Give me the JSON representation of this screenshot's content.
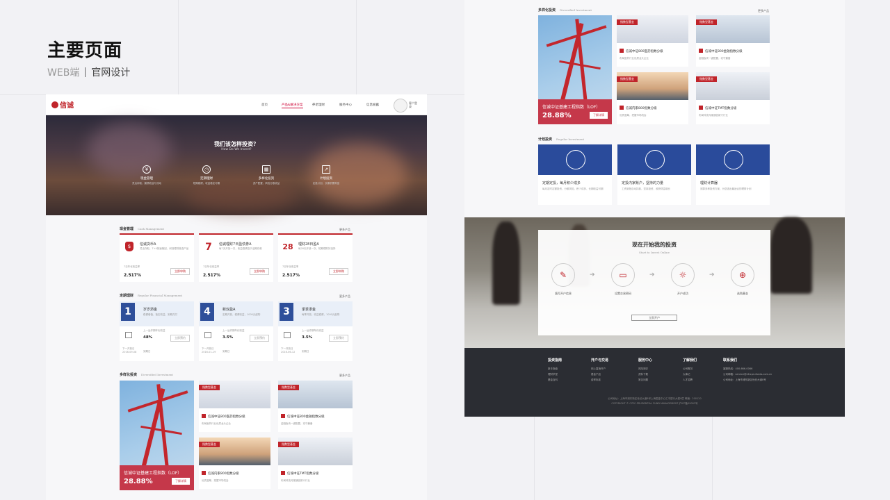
{
  "page": {
    "title": "主要页面",
    "subtitle_a": "WEB端",
    "subtitle_b": "官网设计"
  },
  "nav": {
    "logo": "信诚",
    "items": [
      "首页",
      "产品&解决方案",
      "养老理财",
      "服务中心",
      "信息披露"
    ],
    "active_index": 1,
    "user": "客户登录"
  },
  "hero": {
    "title": "我们该怎样投资？",
    "subtitle": "How Do We Invest?",
    "items": [
      {
        "icon": "yen-icon",
        "label": "现金管理",
        "desc": "灵活存取，兼顾收益与流动"
      },
      {
        "icon": "clock-icon",
        "label": "定期理财",
        "desc": "短期稳健，收益稳定可期"
      },
      {
        "icon": "grid-icon",
        "label": "多样化投资",
        "desc": "资产配置，风险分散收益"
      },
      {
        "icon": "chart-icon",
        "label": "计划投资",
        "desc": "定投计划，长期积累财富"
      }
    ]
  },
  "cash": {
    "title": "现金管理",
    "en": "Cash Management",
    "more": "更多产品",
    "cards": [
      {
        "mark": "$",
        "name": "信诚货币A",
        "desc": "灵活存取，T+0快速赎回，闲钱理财首选产品",
        "label": "7日年化收益率",
        "pct": "2.517%",
        "btn": "立即申购"
      },
      {
        "mark": "7",
        "name": "信诚理财7日盈债券A",
        "desc": "每7天开放一次，收益稳健高于活期存款",
        "label": "7日年化收益率",
        "pct": "2.517%",
        "btn": "立即申购"
      },
      {
        "mark": "28",
        "name": "理财28日盈A",
        "desc": "每28天开放一次，短期理财好选择",
        "label": "7日年化收益率",
        "pct": "2.517%",
        "btn": "立即申购"
      }
    ]
  },
  "periodic": {
    "title": "定期理财",
    "en": "Regular Financial Management",
    "more": "更多产品",
    "cards": [
      {
        "num": "1",
        "name": "岁岁添金",
        "desc": "稳健增值，锁定收益，到期兑付",
        "label": "上一运作期年化收益",
        "pct": "48%",
        "btn": "立即预约",
        "date": "下一开放日\n2016-09-08",
        "dn": "到期日"
      },
      {
        "num": "4",
        "name": "新双盈A",
        "desc": "定期开放，稳健收益，1000元起购",
        "label": "上一运作期年化收益",
        "pct": "3.5%",
        "btn": "立即预约",
        "date": "下一开放日\n2016-01-19",
        "dn": "到期日"
      },
      {
        "num": "3",
        "name": "季季添金",
        "desc": "每季开放，收益稳健，1000元起购",
        "label": "上一运作期年化收益",
        "pct": "3.5%",
        "btn": "立即预约",
        "date": "下一开放日\n2016-06-12",
        "dn": "到期日"
      }
    ]
  },
  "diverse": {
    "title": "多样化投资",
    "en": "Diversified Investment",
    "more": "更多产品",
    "featured": {
      "name": "信诚中证基建工程指数（LOF）",
      "pct": "28.88%",
      "btn": "了解详情"
    },
    "funds": [
      {
        "tag": "指数型基金",
        "name": "信诚中证800医药指数分级",
        "desc": "布局医药行业优质龙头企业",
        "img": "dna"
      },
      {
        "tag": "指数型基金",
        "name": "信诚中证800金融指数分级",
        "desc": "金融板块一键配置，攻守兼备",
        "img": "sky"
      },
      {
        "tag": "指数型基金",
        "name": "信诚内家800指数分级",
        "desc": "优质蓝筹，把握市场机会",
        "img": "city"
      },
      {
        "tag": "指数型基金",
        "name": "信诚中证TMT指数分级",
        "desc": "布局科技传媒通信新兴行业",
        "img": "cup"
      }
    ]
  },
  "plans": {
    "title": "计划投资",
    "en": "Regular Investment",
    "more": "更多产品",
    "cards": [
      {
        "name": "定期定投，每月积少成多",
        "desc": "每月定时定额投资，分散风险，积少成多，长期收益可期"
      },
      {
        "name": "定投内家账户，坚持的力量",
        "desc": "工资到账自动扣款，坚持投资，收获财富增长"
      },
      {
        "name": "理财计算器",
        "desc": "测算多种投资方案，为您选出最适合的理财计划"
      }
    ]
  },
  "start": {
    "title": "现在开始我的投资",
    "subtitle": "Start to Invest Online",
    "steps": [
      {
        "icon": "form-icon",
        "label": "填写开户信息"
      },
      {
        "icon": "card-icon",
        "label": "设置交易密码"
      },
      {
        "icon": "bulb-icon",
        "label": "开户成功"
      },
      {
        "icon": "cart-icon",
        "label": "选购基金"
      }
    ],
    "btn": "立即开户"
  },
  "footer": {
    "cols": [
      {
        "h": "投资指南",
        "items": [
          "新手指南",
          "理财学堂",
          "基金百科"
        ]
      },
      {
        "h": "开户与交易",
        "items": [
          "网上直销开户",
          "基金产品",
          "费率标准"
        ]
      },
      {
        "h": "服务中心",
        "items": [
          "风险测评",
          "资料下载",
          "常见问题"
        ]
      },
      {
        "h": "了解我们",
        "items": [
          "公司概况",
          "大事记",
          "人才招聘"
        ]
      },
      {
        "h": "联系我们",
        "items": [
          "客服热线：400-666-0066",
          "公司邮箱：service@citicprufunds.com.cn",
          "公司地址：上海市浦东新区世纪大道8号"
        ]
      }
    ],
    "copy1": "公司地址：上海市浦东新区世纪大道8号上海国金中心汇丰银行大楼9层 邮编：200120",
    "copy2": "COPYRIGHT © CITIC-PRUDENTIAL FUND MANAGEMENT 沪ICP备09003号"
  }
}
